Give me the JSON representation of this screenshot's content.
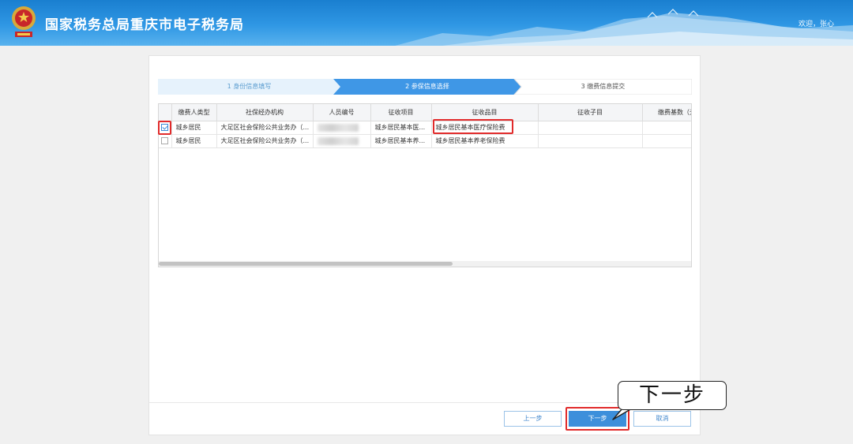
{
  "header": {
    "title": "国家税务总局重庆市电子税务局",
    "welcome": "欢迎，张心"
  },
  "stepper": {
    "steps": [
      {
        "label": "1 身份信息填写",
        "state": "done"
      },
      {
        "label": "2 参保信息选择",
        "state": "active"
      },
      {
        "label": "3 缴费信息提交",
        "state": "pending"
      }
    ]
  },
  "grid": {
    "columns": [
      "缴费人类型",
      "社保经办机构",
      "人员编号",
      "征收项目",
      "征收品目",
      "征收子目",
      "缴费基数（元"
    ],
    "rows": [
      {
        "checked": true,
        "cells": [
          "城乡居民",
          "大足区社会保险公共业务办（...",
          "",
          "城乡居民基本医...",
          "城乡居民基本医疗保险费",
          "",
          ""
        ]
      },
      {
        "checked": false,
        "cells": [
          "城乡居民",
          "大足区社会保险公共业务办（...",
          "",
          "城乡居民基本养...",
          "城乡居民基本养老保险费",
          "",
          ""
        ]
      }
    ]
  },
  "footer": {
    "prev": "上一步",
    "next": "下一步",
    "cancel": "取消"
  },
  "annotation": {
    "callout": "下一步"
  },
  "colors": {
    "primary": "#3d8fdb",
    "highlight": "#e12b2b",
    "banner": "#2f97e4"
  }
}
